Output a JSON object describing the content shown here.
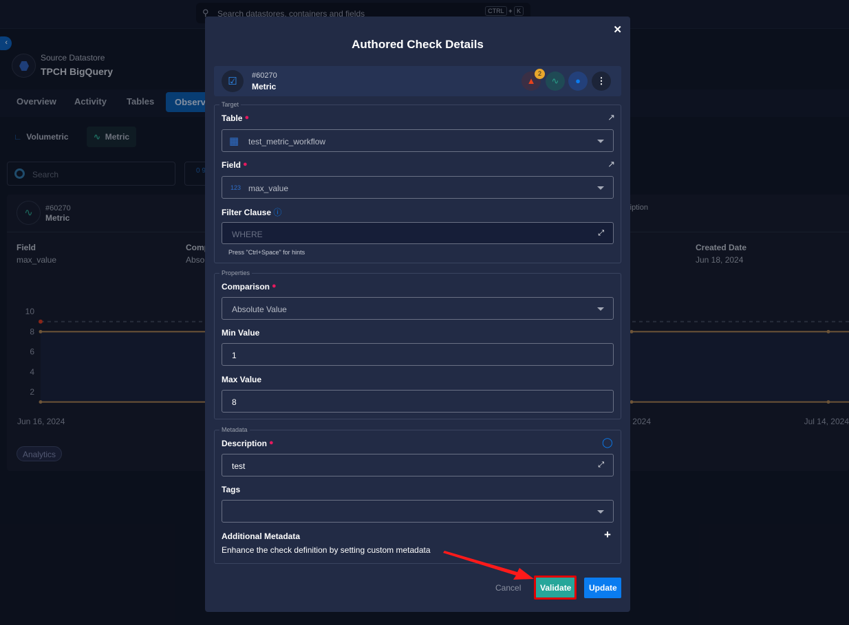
{
  "topbar": {
    "search_placeholder": "Search datastores, containers and fields",
    "shortcut_ctrl": "CTRL",
    "shortcut_plus": "+",
    "shortcut_key": "K"
  },
  "datastore": {
    "label": "Source Datastore",
    "name": "TPCH BigQuery"
  },
  "tabs": [
    "Overview",
    "Activity",
    "Tables",
    "Observa"
  ],
  "subtabs": [
    "Volumetric",
    "Metric"
  ],
  "list": {
    "search_placeholder": "Search",
    "sort_icon_text": "0 9"
  },
  "card": {
    "id": "#60270",
    "type": "Metric",
    "field_label": "Field",
    "field_value": "max_value",
    "comparison_label": "Comp",
    "comparison_value": "Abso",
    "description_label": "ription",
    "created_label": "Created Date",
    "created_value": "Jun 18, 2024",
    "tag": "Analytics",
    "chart": {
      "y_ticks": [
        "10",
        "8",
        "6",
        "4",
        "2"
      ],
      "x_ticks": [
        "Jun 16, 2024",
        "2024",
        "Jul 14, 2024"
      ],
      "upper_bound": 8,
      "lower_bound": 1,
      "dashed_value": 9,
      "anomaly_value": 9,
      "ylim": [
        1,
        10
      ],
      "colors": {
        "bound": "#a57d4e",
        "anomaly": "#d1361c",
        "dashed": "#3a4153"
      }
    }
  },
  "modal": {
    "title": "Authored Check Details",
    "check_id": "#60270",
    "check_type": "Metric",
    "alert_count": "2",
    "target": {
      "legend": "Target",
      "table_label": "Table",
      "table_value": "test_metric_workflow",
      "field_label": "Field",
      "field_type": "123",
      "field_value": "max_value",
      "filter_label": "Filter Clause",
      "filter_placeholder": "WHERE",
      "filter_hint": "Press \"Ctrl+Space\" for hints"
    },
    "properties": {
      "legend": "Properties",
      "comparison_label": "Comparison",
      "comparison_value": "Absolute Value",
      "min_label": "Min Value",
      "min_value": "1",
      "max_label": "Max Value",
      "max_value": "8"
    },
    "metadata": {
      "legend": "Metadata",
      "description_label": "Description",
      "description_value": "test",
      "tags_label": "Tags",
      "additional_label": "Additional Metadata",
      "additional_hint": "Enhance the check definition by setting custom metadata"
    },
    "buttons": {
      "cancel": "Cancel",
      "validate": "Validate",
      "update": "Update"
    }
  },
  "colors": {
    "accent": "#0a7cf0",
    "validate": "#26a69a",
    "required": "#e5195e",
    "highlight": "#e00000"
  }
}
